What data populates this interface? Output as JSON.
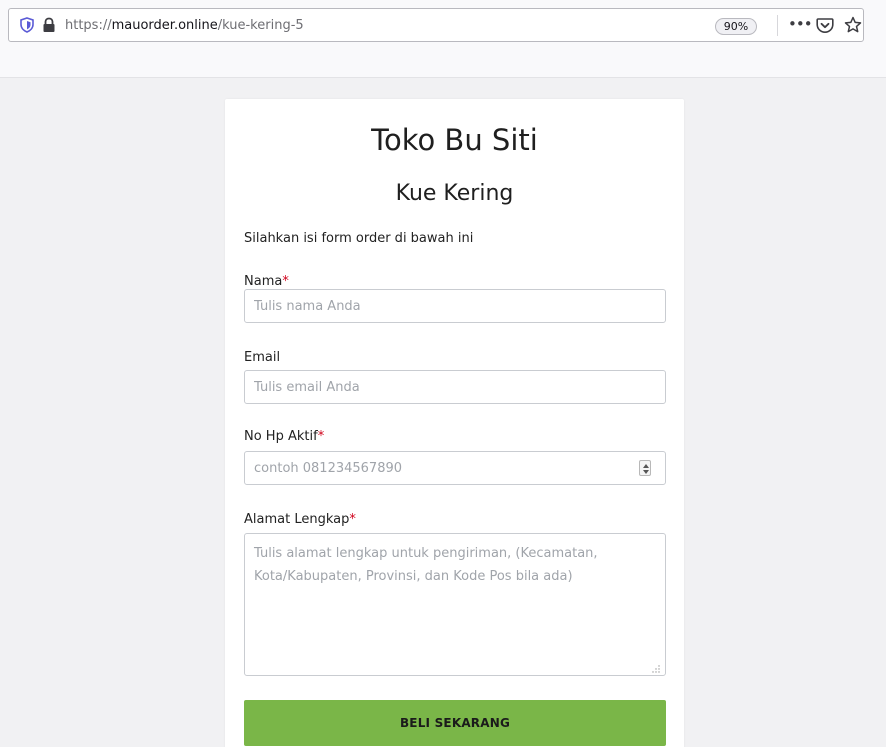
{
  "browser": {
    "url_prefix": "https://",
    "url_host": "mauorder.online",
    "url_path": "/kue-kering-5",
    "zoom": "90%",
    "more_icon": "•••"
  },
  "form": {
    "shop_name": "Toko Bu Siti",
    "product_name": "Kue Kering",
    "intro": "Silahkan isi form order di bawah ini",
    "required_mark": "*",
    "fields": {
      "name": {
        "label": "Nama",
        "placeholder": "Tulis nama Anda",
        "value": ""
      },
      "email": {
        "label": "Email",
        "placeholder": "Tulis email Anda",
        "value": ""
      },
      "phone": {
        "label": "No Hp Aktif",
        "placeholder": "contoh 081234567890",
        "value": ""
      },
      "address": {
        "label": "Alamat Lengkap",
        "placeholder": "Tulis alamat lengkap untuk pengiriman, (Kecamatan, Kota/Kabupaten, Provinsi, dan Kode Pos bila ada)",
        "value": ""
      }
    },
    "submit_label": "BELI SEKARANG"
  },
  "colors": {
    "accent": "#7ab648",
    "required": "#d0021b"
  },
  "icons": [
    "shield-icon",
    "lock-icon",
    "more-icon",
    "pocket-icon",
    "bookmark-star-icon",
    "number-spinner-icon",
    "resize-grip-icon"
  ]
}
